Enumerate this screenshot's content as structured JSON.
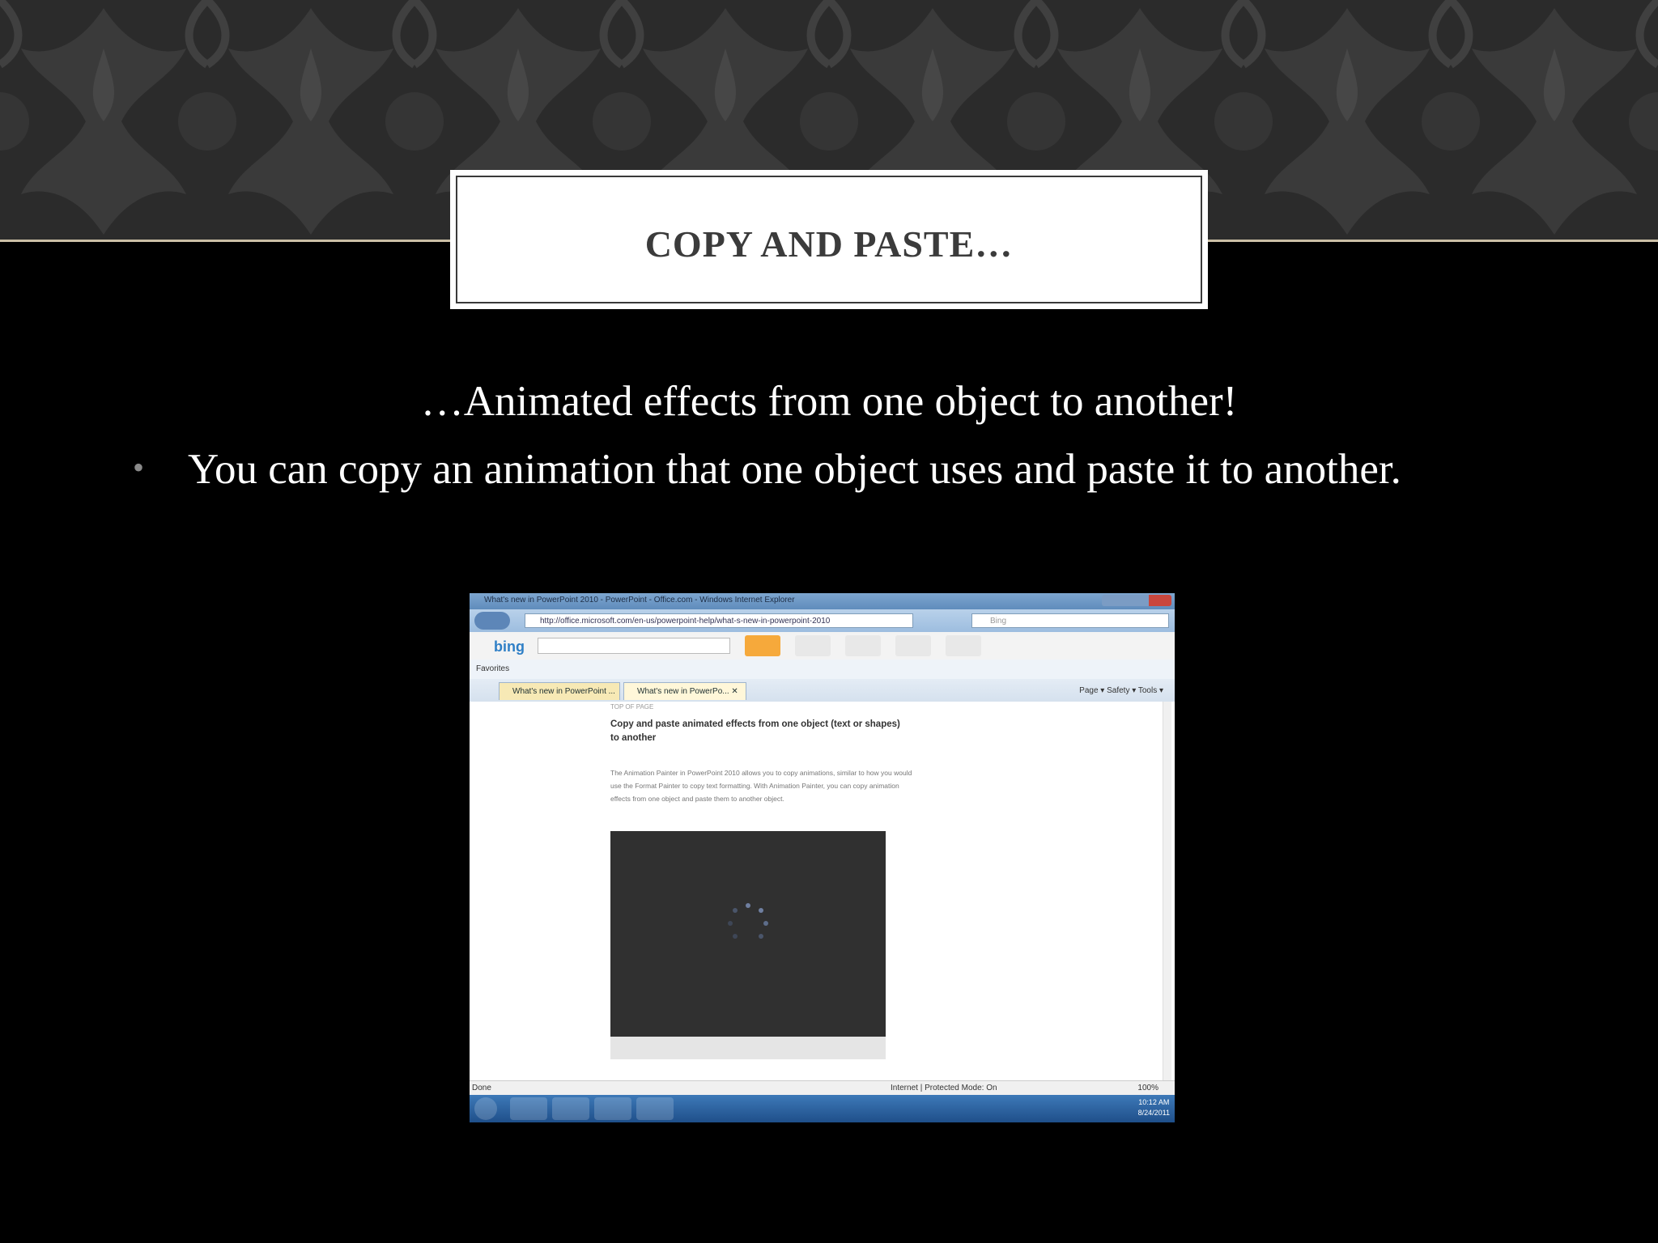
{
  "slide": {
    "title": "COPY AND PASTE…",
    "subtitle": "…Animated effects from one object to another!",
    "bullet": "You can copy an animation that one object uses and paste it to another."
  },
  "screenshot": {
    "window_title": "What's new in PowerPoint 2010 - PowerPoint - Office.com - Windows Internet Explorer",
    "url": "http://office.microsoft.com/en-us/powerpoint-help/what-s-new-in-powerpoint-2010",
    "search_placeholder": "Bing",
    "bing_logo": "bing",
    "favorites_label": "Favorites",
    "tabs": [
      "What's new in PowerPoint ...",
      "What's new in PowerPo... ✕"
    ],
    "commands": "Page ▾   Safety ▾   Tools ▾",
    "top_of_page": "TOP OF PAGE",
    "heading": "Copy and paste animated effects from one object (text or shapes) to another",
    "body": "The Animation Painter in PowerPoint 2010 allows you to copy animations, similar to how you would use the Format Painter to copy text formatting. With Animation Painter, you can copy animation effects from one object and paste them to another object.",
    "status_left": "Done",
    "status_zone": "Internet | Protected Mode: On",
    "zoom": "100%",
    "clock_time": "10:12 AM",
    "clock_date": "8/24/2011"
  }
}
